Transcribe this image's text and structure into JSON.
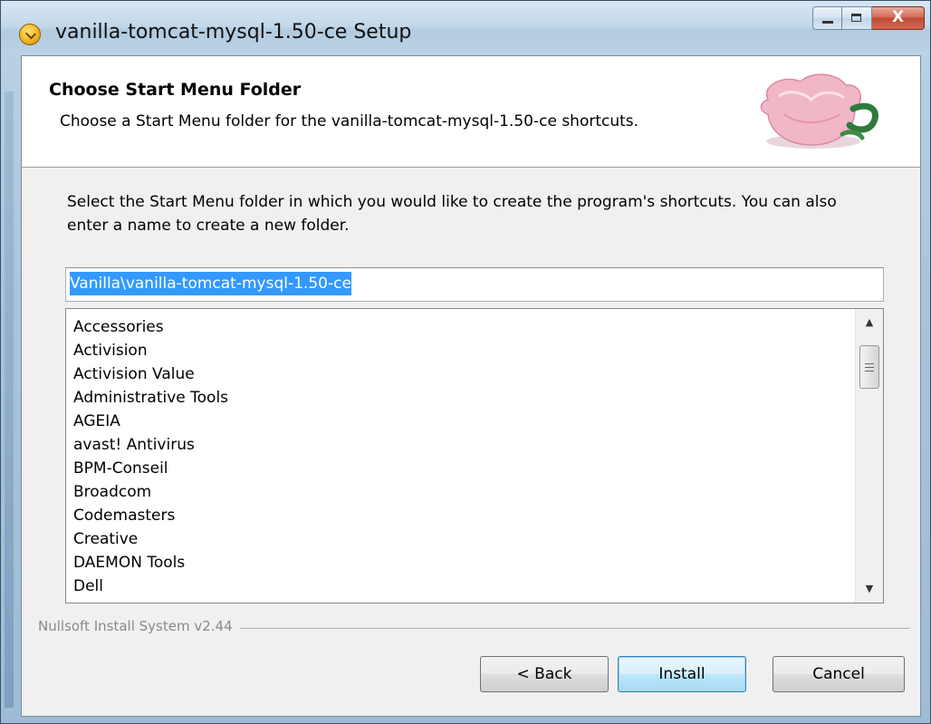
{
  "window": {
    "title": "vanilla-tomcat-mysql-1.50-ce Setup",
    "caption_buttons": {
      "minimize_icon": "minimize-icon",
      "maximize_icon": "maximize-icon",
      "close_glyph": "X"
    }
  },
  "header": {
    "title": "Choose Start Menu Folder",
    "subtitle": "Choose a Start Menu folder for the vanilla-tomcat-mysql-1.50-ce shortcuts.",
    "image": "teacup-image"
  },
  "body": {
    "instructions": "Select the Start Menu folder in which you would like to create the program's shortcuts. You can also enter a name to create a new folder.",
    "folder_input": {
      "value": "Vanilla\\vanilla-tomcat-mysql-1.50-ce"
    },
    "folders": [
      "Accessories",
      "Activision",
      "Activision Value",
      "Administrative Tools",
      "AGEIA",
      "avast! Antivirus",
      "BPM-Conseil",
      "Broadcom",
      "Codemasters",
      "Creative",
      "DAEMON Tools",
      "Dell"
    ]
  },
  "footer": {
    "brand": "Nullsoft Install System v2.44",
    "back_label": "< Back",
    "install_label": "Install",
    "cancel_label": "Cancel"
  },
  "colors": {
    "selection": "#3399ff",
    "default_button_border": "#3c7fb1"
  }
}
